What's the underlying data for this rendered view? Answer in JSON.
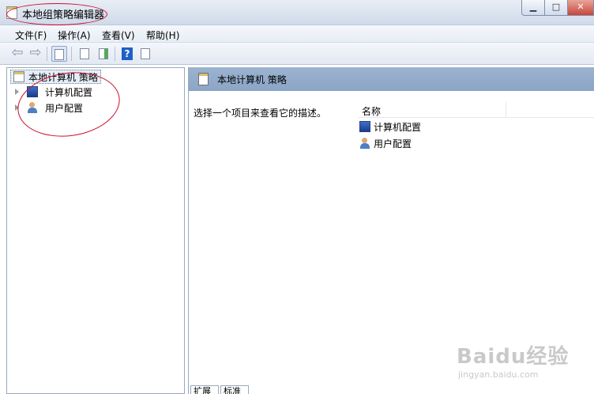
{
  "window": {
    "title": "本地组策略编辑器",
    "buttons": {
      "minimize": "▁",
      "maximize": "□",
      "close": "✕"
    }
  },
  "menu": [
    "文件(F)",
    "操作(A)",
    "查看(V)",
    "帮助(H)"
  ],
  "toolbar": {
    "icons": [
      "back-arrow-icon",
      "forward-arrow-icon",
      "show-hide-tree-icon",
      "properties-icon",
      "export-list-icon",
      "help-icon",
      "show-hide-action-pane-icon"
    ],
    "help_glyph": "?"
  },
  "tree": {
    "root": "本地计算机 策略",
    "children": [
      "计算机配置",
      "用户配置"
    ]
  },
  "right_pane": {
    "header_title": "本地计算机 策略",
    "description": "选择一个项目来查看它的描述。",
    "column_header": "名称",
    "items": [
      "计算机配置",
      "用户配置"
    ]
  },
  "tabs": [
    "扩展",
    "标准"
  ],
  "watermark": {
    "brand": "Baidu经验",
    "url": "jingyan.baidu.com"
  },
  "colors": {
    "annotation": "#c8102e",
    "header": "#9cb3d0"
  }
}
